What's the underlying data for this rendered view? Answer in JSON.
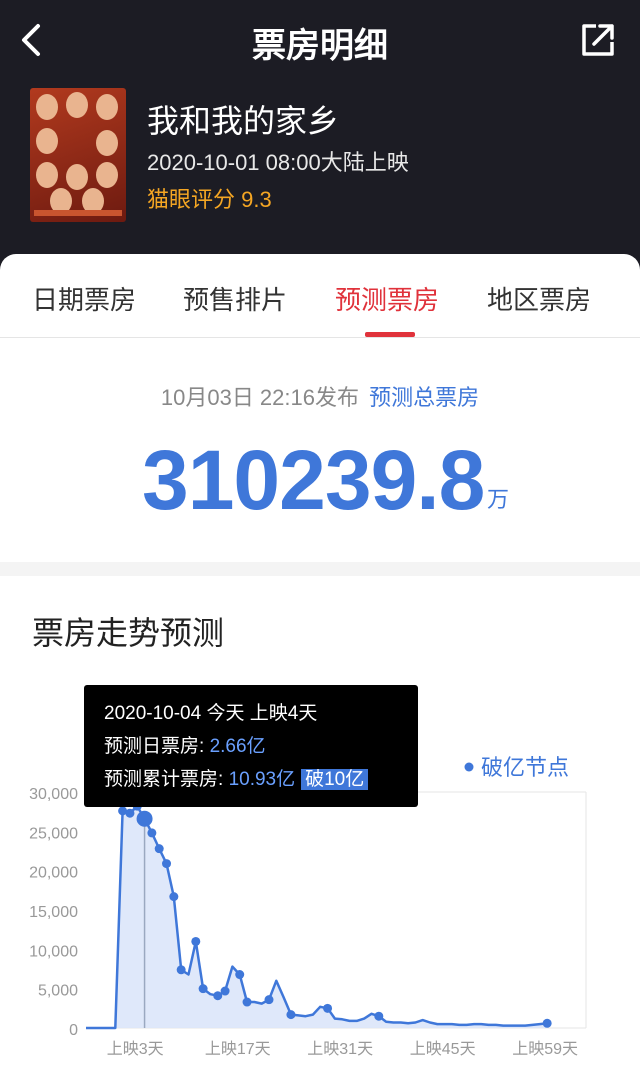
{
  "nav": {
    "title": "票房明细",
    "back_icon": "chevron-left-icon",
    "share_icon": "share-icon"
  },
  "movie": {
    "name": "我和我的家乡",
    "release": "2020-10-01 08:00大陆上映",
    "score": "猫眼评分 9.3",
    "poster_title": "我和我的家乡"
  },
  "tabs": [
    {
      "label": "日期票房"
    },
    {
      "label": "预售排片"
    },
    {
      "label": "预测票房",
      "active": true
    },
    {
      "label": "地区票房"
    }
  ],
  "forecast": {
    "publish_time": "10月03日  22:16发布",
    "publish_link": "预测总票房",
    "total": "310239.8",
    "unit": "万"
  },
  "trend": {
    "title": "票房走势预测",
    "legend": "破亿节点",
    "tooltip": {
      "line1": "2020-10-04 今天 上映4天",
      "daily_label": "预测日票房: ",
      "daily_value": "2.66亿",
      "cum_label": "预测累计票房: ",
      "cum_value": "10.93亿",
      "badge": "破10亿"
    }
  },
  "colors": {
    "accent": "#3f77d9",
    "active_tab": "#e0323b",
    "score": "#f5a623",
    "header_bg": "#1c1c24"
  },
  "chart_data": {
    "type": "line",
    "xlabel": "",
    "ylabel": "",
    "ylim": [
      0,
      30000
    ],
    "y_ticks": [
      "0",
      "5,000",
      "10,000",
      "15,000",
      "20,000",
      "25,000",
      "30,000"
    ],
    "x_tick_labels": [
      {
        "day": 3,
        "label": "上映3天"
      },
      {
        "day": 17,
        "label": "上映17天"
      },
      {
        "day": 31,
        "label": "上映31天"
      },
      {
        "day": 45,
        "label": "上映45天"
      },
      {
        "day": 59,
        "label": "上映59天"
      }
    ],
    "selected_day": 4,
    "points": [
      [
        -4,
        0
      ],
      [
        -3,
        0
      ],
      [
        -2,
        0
      ],
      [
        -1,
        0
      ],
      [
        0,
        0
      ],
      [
        1,
        27600
      ],
      [
        2,
        27300
      ],
      [
        3,
        28200
      ],
      [
        4,
        26600
      ],
      [
        5,
        24800
      ],
      [
        6,
        22800
      ],
      [
        7,
        20900
      ],
      [
        8,
        16700
      ],
      [
        9,
        7400
      ],
      [
        10,
        6800
      ],
      [
        11,
        11000
      ],
      [
        12,
        5000
      ],
      [
        13,
        4300
      ],
      [
        14,
        4100
      ],
      [
        15,
        4700
      ],
      [
        16,
        7800
      ],
      [
        17,
        6800
      ],
      [
        18,
        3300
      ],
      [
        19,
        3300
      ],
      [
        20,
        3100
      ],
      [
        21,
        3600
      ],
      [
        22,
        6000
      ],
      [
        23,
        3900
      ],
      [
        24,
        1700
      ],
      [
        25,
        1600
      ],
      [
        26,
        1500
      ],
      [
        27,
        1700
      ],
      [
        28,
        2700
      ],
      [
        29,
        2500
      ],
      [
        30,
        1200
      ],
      [
        31,
        1100
      ],
      [
        32,
        900
      ],
      [
        33,
        900
      ],
      [
        34,
        1200
      ],
      [
        35,
        1800
      ],
      [
        36,
        1500
      ],
      [
        37,
        800
      ],
      [
        38,
        700
      ],
      [
        39,
        700
      ],
      [
        40,
        600
      ],
      [
        41,
        700
      ],
      [
        42,
        1000
      ],
      [
        43,
        700
      ],
      [
        44,
        500
      ],
      [
        45,
        500
      ],
      [
        46,
        500
      ],
      [
        47,
        400
      ],
      [
        48,
        400
      ],
      [
        49,
        500
      ],
      [
        50,
        500
      ],
      [
        51,
        400
      ],
      [
        52,
        400
      ],
      [
        53,
        300
      ],
      [
        54,
        300
      ],
      [
        55,
        300
      ],
      [
        56,
        300
      ],
      [
        57,
        400
      ],
      [
        58,
        500
      ],
      [
        59,
        600
      ]
    ],
    "markers": [
      1,
      2,
      3,
      4,
      5,
      6,
      7,
      8,
      9,
      11,
      12,
      14,
      15,
      17,
      18,
      21,
      24,
      29,
      36,
      59
    ],
    "milestones": [
      4
    ]
  }
}
